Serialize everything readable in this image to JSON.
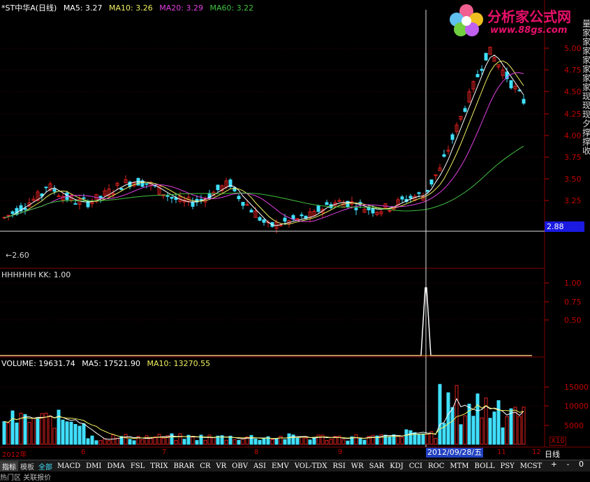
{
  "header": {
    "title": "*ST中华A(日线)",
    "ma5": "MA5: 3.27",
    "ma10": "MA10: 3.26",
    "ma20": "MA20: 3.29",
    "ma60": "MA60: 3.22"
  },
  "logo": {
    "name": "分析家公式网",
    "url": "www.88gs.com"
  },
  "price_axis": [
    "5.00",
    "4.75",
    "4.50",
    "4.25",
    "4.00",
    "3.75",
    "3.50",
    "3.25"
  ],
  "cursor_price": "2.88",
  "low_label": "2.60",
  "kk_panel": {
    "label": "HHHHHH  KK: 1.00",
    "ticks": [
      "1.00",
      "0.75",
      "0.50"
    ]
  },
  "volume_panel": {
    "vol": "VOLUME: 19631.74",
    "ma5": "MA5: 17521.90",
    "ma10": "MA10: 13270.55",
    "ticks": [
      "15000",
      "10000",
      "5000"
    ],
    "multiplier": "X10"
  },
  "date_axis": {
    "months": [
      "2012年",
      "6",
      "7",
      "8",
      "9",
      "11",
      "12"
    ],
    "cursor_date": "2012/09/28/五",
    "period": "日线"
  },
  "right_column_text": "量家家家家家家家现现现夕撑撑收",
  "tabs": [
    "指标",
    "模板"
  ],
  "all_tab": "全部",
  "indicators": [
    "MACD",
    "DMI",
    "DMA",
    "FSL",
    "TRIX",
    "BRAR",
    "CR",
    "VR",
    "OBV",
    "ASI",
    "EMV",
    "VOL-TDX",
    "RSI",
    "WR",
    "SAR",
    "KDJ",
    "CCI",
    "ROC",
    "MTM",
    "BOLL",
    "PSY",
    "MCST"
  ],
  "zoom_controls": [
    "+",
    "-",
    "0"
  ],
  "bottom_text": "热门区  关联报价",
  "colors": {
    "up": "#e02020",
    "down": "#40e0ff",
    "ma5": "#ffffff",
    "ma10": "#f0f060",
    "ma20": "#e040e0",
    "ma60": "#40c040"
  },
  "chart_data": {
    "type": "candlestick",
    "cursor_date": "2012/09/28",
    "kk_signal_value": 1.0,
    "price_range": [
      2.6,
      5.1
    ]
  }
}
